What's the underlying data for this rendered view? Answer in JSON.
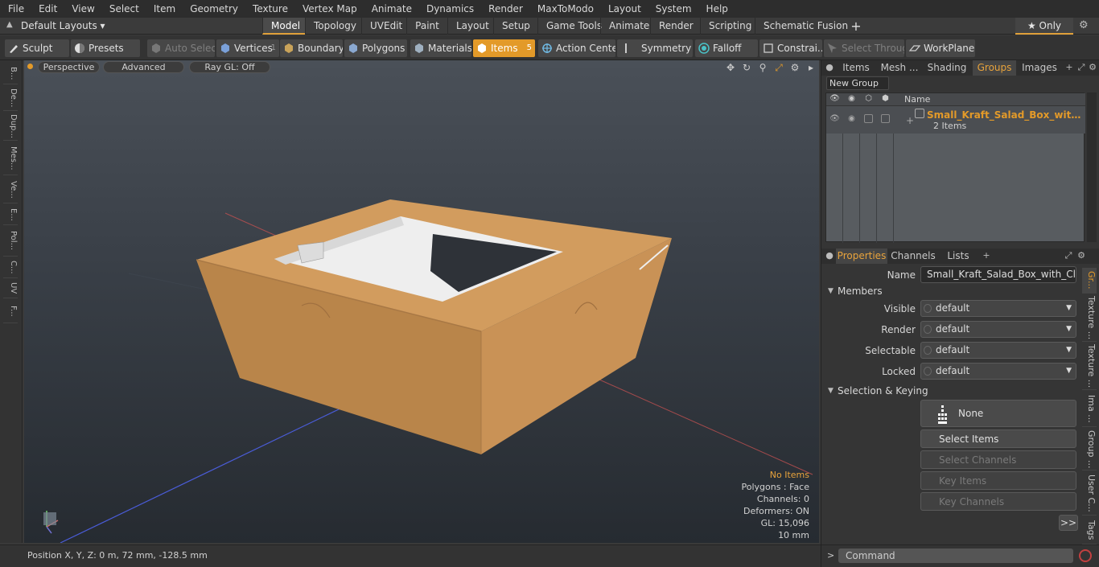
{
  "menu": [
    "File",
    "Edit",
    "View",
    "Select",
    "Item",
    "Geometry",
    "Texture",
    "Vertex Map",
    "Animate",
    "Dynamics",
    "Render",
    "MaxToModo",
    "Layout",
    "System",
    "Help"
  ],
  "layout_dropdown": "Default Layouts ▾",
  "mode_tabs": [
    "Model",
    "Topology",
    "UVEdit",
    "Paint",
    "Layout",
    "Setup",
    "Game Tools",
    "Animate",
    "Render",
    "Scripting",
    "Schematic Fusion"
  ],
  "active_mode": "Model",
  "only_label": "★ Only",
  "toolbar": {
    "sculpt": "Sculpt",
    "presets": "Presets",
    "auto_select": "Auto Select",
    "vertices": "Vertices",
    "vertices_count": "1",
    "boundary": "Boundary",
    "polygons": "Polygons",
    "materials": "Materials",
    "items": "Items",
    "items_count": "5",
    "action_center": "Action Center",
    "symmetry": "Symmetry",
    "falloff": "Falloff",
    "constraints": "Constrai...",
    "select_through": "Select Through",
    "workplane": "WorkPlane"
  },
  "left_tabs": [
    "B...",
    "De...",
    "Dup...",
    "Mes...",
    "Ve...",
    "E...",
    "Pol...",
    "C...",
    "UV",
    "F..."
  ],
  "viewport": {
    "view": "Perspective",
    "shading": "Advanced",
    "raygl": "Ray GL: Off",
    "stats": {
      "items": "No Items",
      "polygons": "Polygons : Face",
      "channels": "Channels: 0",
      "deformers": "Deformers: ON",
      "gl": "GL: 15,096",
      "scale": "10 mm"
    }
  },
  "status": {
    "position": "Position X, Y, Z:   0 m, 72 mm, -128.5 mm"
  },
  "right_tabs": [
    "Items",
    "Mesh ...",
    "Shading",
    "Groups",
    "Images"
  ],
  "active_right_tab": "Groups",
  "new_group": "New Group",
  "groups_table": {
    "name_header": "Name",
    "group_name": "Small_Kraft_Salad_Box_with_Cl ...",
    "group_sub": "2 Items"
  },
  "prop_tabs": [
    "Properties",
    "Channels",
    "Lists"
  ],
  "properties": {
    "name_label": "Name",
    "name_value": "Small_Kraft_Salad_Box_with_Clear_W",
    "members_section": "Members",
    "visible_label": "Visible",
    "visible_value": "default",
    "render_label": "Render",
    "render_value": "default",
    "selectable_label": "Selectable",
    "selectable_value": "default",
    "locked_label": "Locked",
    "locked_value": "default",
    "selkey_section": "Selection & Keying",
    "none_btn": "None",
    "select_items": "Select Items",
    "select_channels": "Select Channels",
    "key_items": "Key Items",
    "key_channels": "Key Channels",
    "more": ">>"
  },
  "side_vtabs": [
    "Gr...",
    "Texture ...",
    "Texture ...",
    "Ima ...",
    "Group ...",
    "User C...",
    "Tags"
  ],
  "command_placeholder": "Command",
  "colors": {
    "accent": "#e39a29",
    "panel": "#353535",
    "viewport_top": "#4a5058",
    "viewport_bottom": "#262b31"
  }
}
